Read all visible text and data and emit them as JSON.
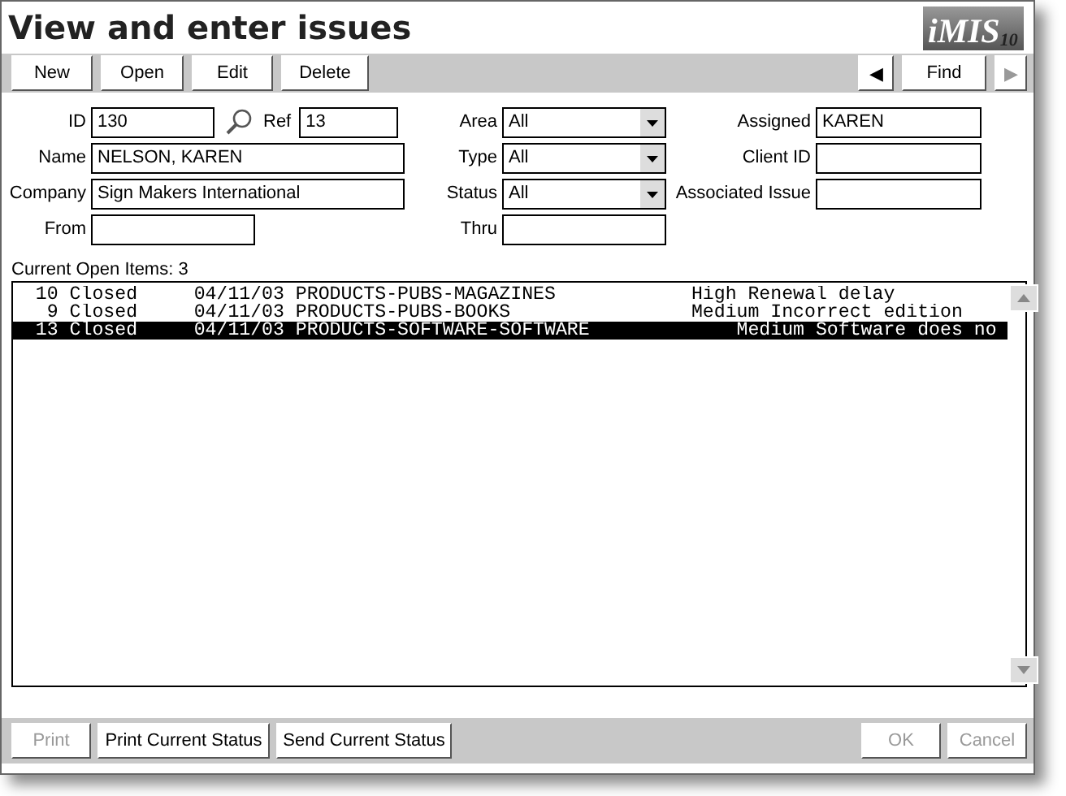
{
  "window": {
    "title": "View and enter issues",
    "logo": {
      "name": "iMIS",
      "version": "10"
    }
  },
  "toolbar": {
    "buttons": [
      {
        "label": "New",
        "disabled": false
      },
      {
        "label": "Open",
        "disabled": false
      },
      {
        "label": "Edit",
        "disabled": false
      },
      {
        "label": "Delete",
        "disabled": false
      }
    ],
    "nav": {
      "prev": {
        "label": "◀",
        "disabled": false
      },
      "find": {
        "label": "Find",
        "disabled": false
      },
      "next": {
        "label": "▶",
        "disabled": true
      }
    }
  },
  "form": {
    "id": {
      "label": "ID",
      "value": "130"
    },
    "ref": {
      "label": "Ref",
      "value": "13"
    },
    "name": {
      "label": "Name",
      "value": "NELSON, KAREN"
    },
    "company": {
      "label": "Company",
      "value": "Sign Makers International"
    },
    "from": {
      "label": "From"
    },
    "area": {
      "label": "Area",
      "value": "All"
    },
    "type": {
      "label": "Type",
      "value": "All"
    },
    "status": {
      "label": "Status",
      "value": "All"
    },
    "thru": {
      "label": "Thru"
    },
    "assigned": {
      "label": "Assigned",
      "value": "KAREN"
    },
    "client_id": {
      "label": "Client ID"
    },
    "associated_issue": {
      "label": "Associated Issue"
    }
  },
  "list": {
    "caption": "Current Open Items: 3",
    "rows": [
      {
        "text": "  10 Closed     04/11/03 PRODUCTS-PUBS-MAGAZINES            High Renewal delay",
        "selected": false
      },
      {
        "text": "   9 Closed     04/11/03 PRODUCTS-PUBS-BOOKS                Medium Incorrect edition",
        "selected": false
      },
      {
        "text": "  13 Closed     04/11/03 PRODUCTS-SOFTWARE-SOFTWARE             Medium Software does no",
        "selected": true
      }
    ]
  },
  "footer": {
    "left": [
      {
        "label": "Print",
        "disabled": true
      },
      {
        "label": "Print Current Status",
        "disabled": false
      },
      {
        "label": "Send Current Status",
        "disabled": false
      }
    ],
    "right": [
      {
        "label": "OK",
        "disabled": true
      },
      {
        "label": "Cancel",
        "disabled": true
      }
    ]
  }
}
